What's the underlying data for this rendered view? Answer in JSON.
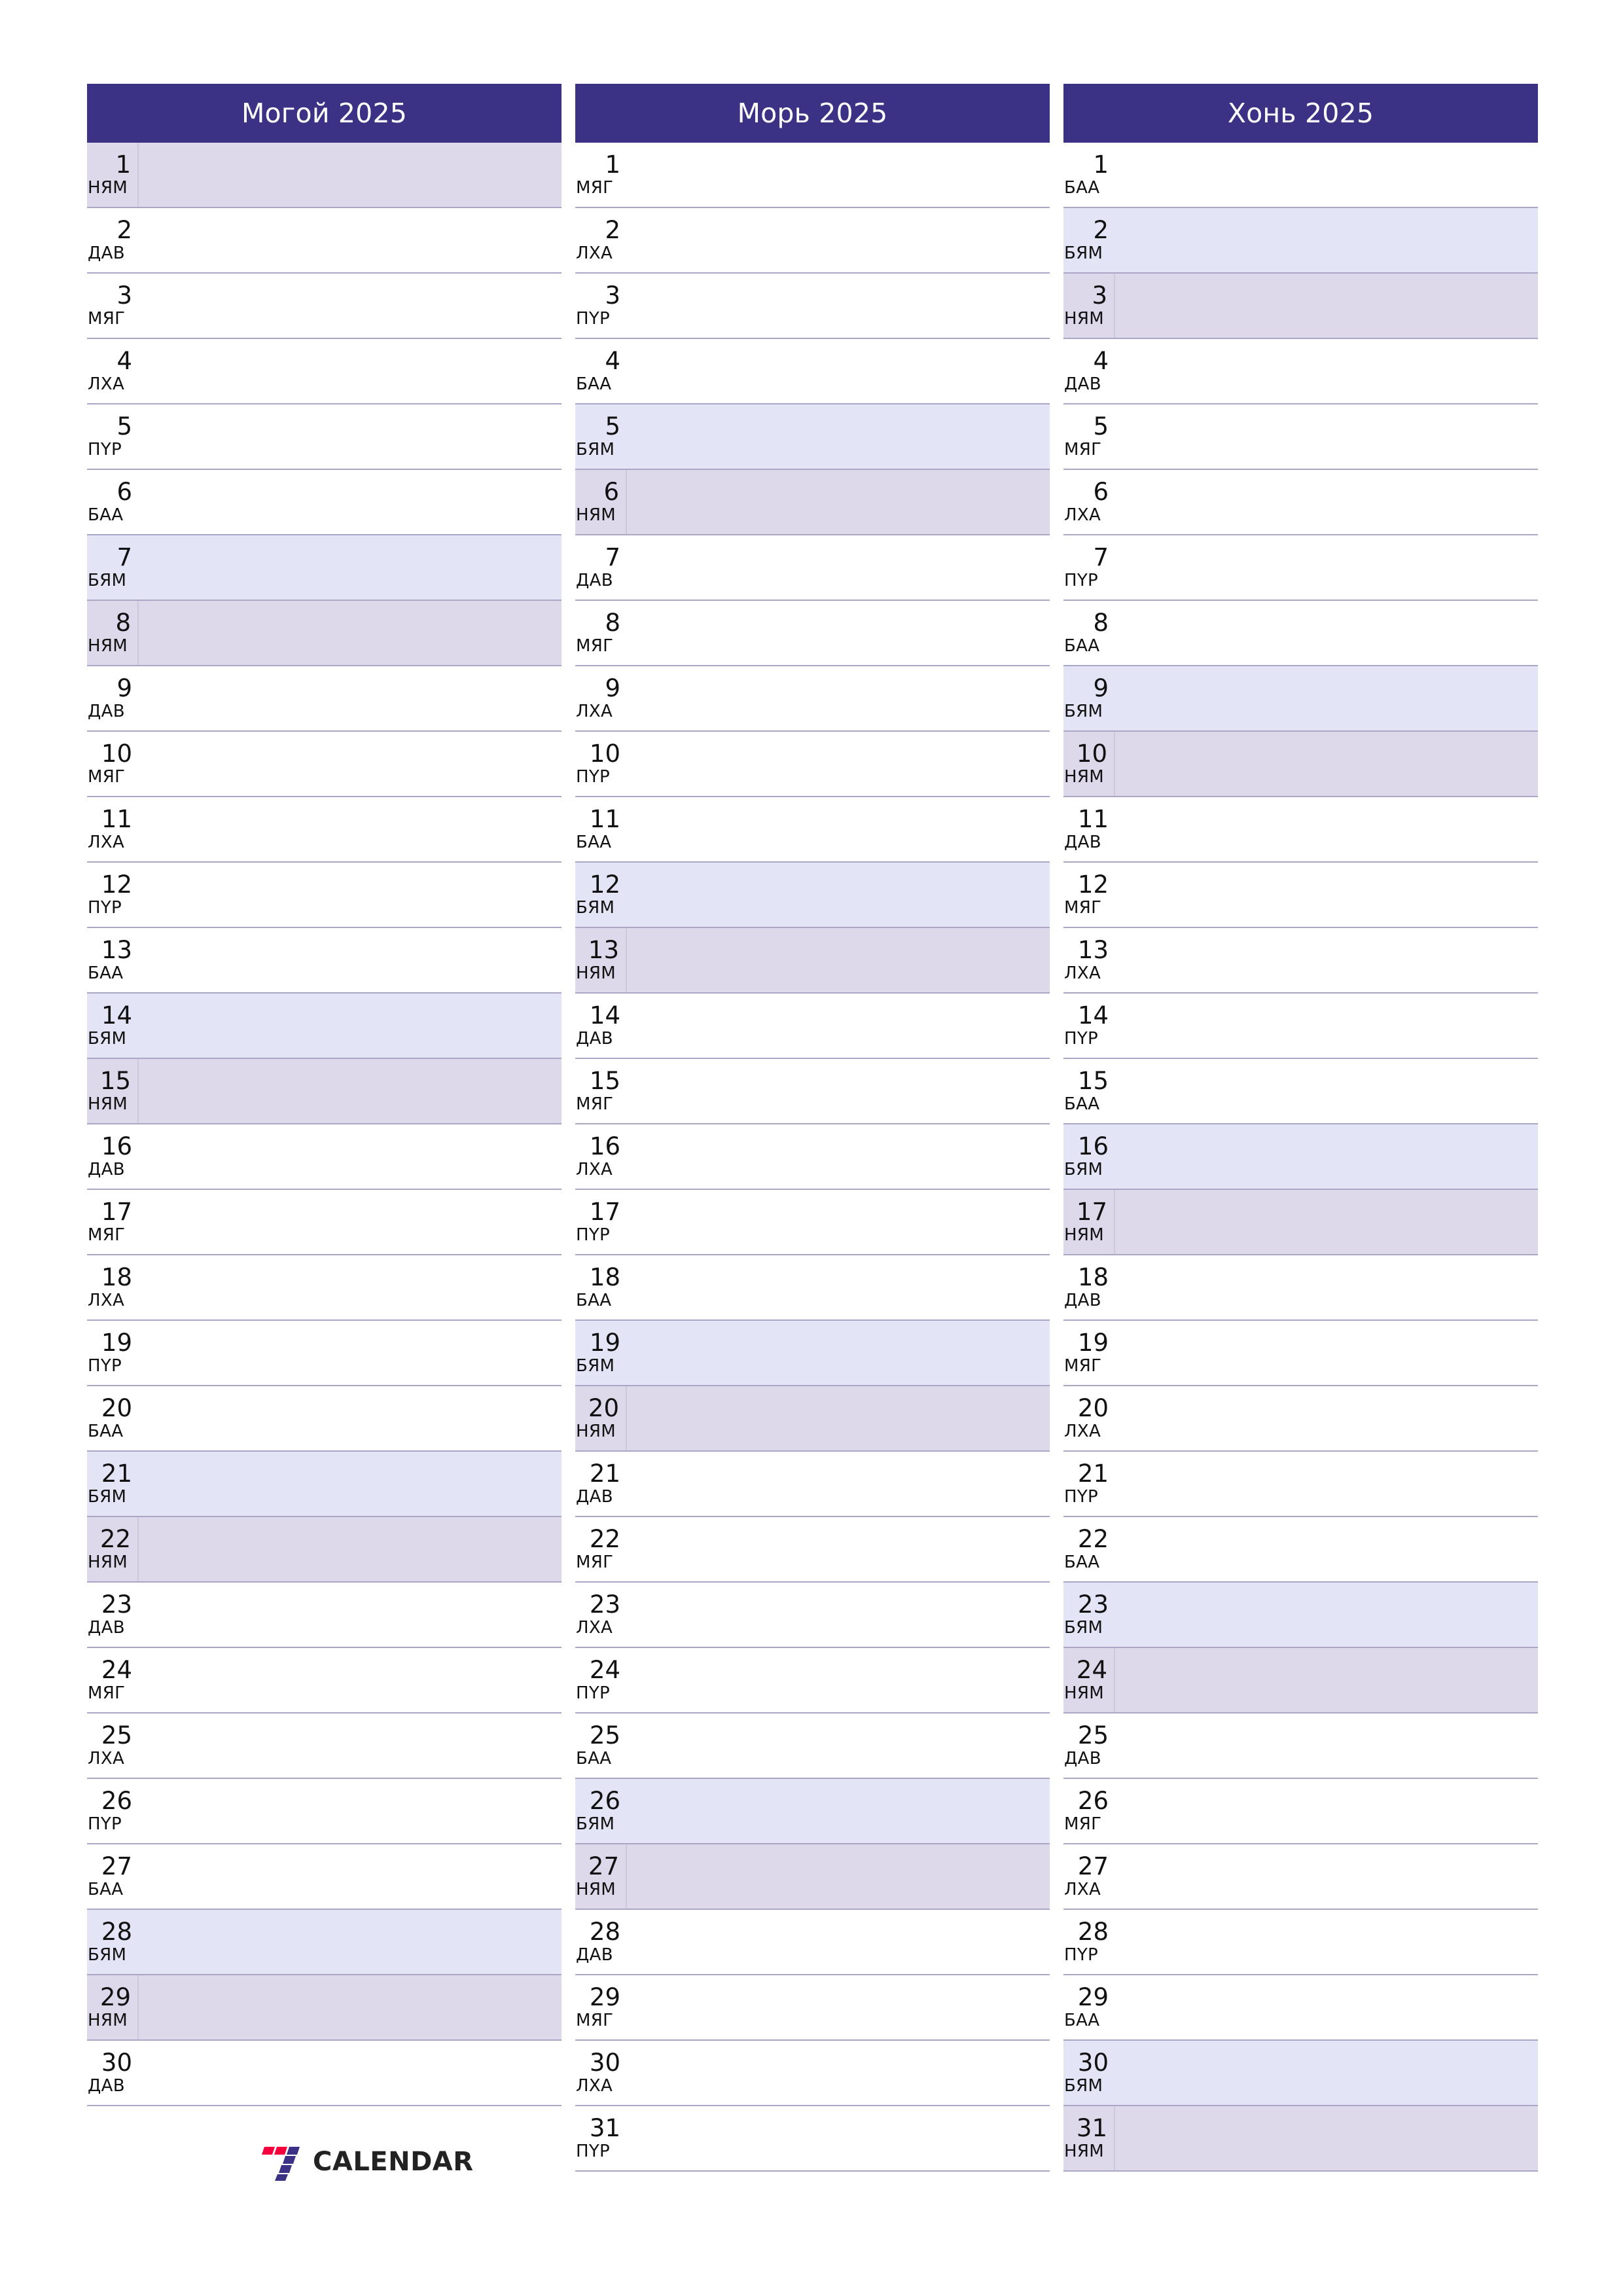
{
  "page": {
    "background_color": "#ffffff",
    "header_color": "#3b3185",
    "saturday_color": "#e3e4f5",
    "sunday_color": "#ddd9ea",
    "grid_line_color": "#a9a6c6"
  },
  "brand": {
    "name": "CALENDAR",
    "logo_icon": "seven-logo-icon",
    "logo_colors": {
      "red": "#f5003c",
      "blue": "#3b3185"
    }
  },
  "months": [
    {
      "title": "Могой 2025",
      "days": [
        {
          "n": "1",
          "wd": "НЯМ",
          "type": "sun"
        },
        {
          "n": "2",
          "wd": "ДАВ",
          "type": "weekday"
        },
        {
          "n": "3",
          "wd": "МЯГ",
          "type": "weekday"
        },
        {
          "n": "4",
          "wd": "ЛХА",
          "type": "weekday"
        },
        {
          "n": "5",
          "wd": "ПҮР",
          "type": "weekday"
        },
        {
          "n": "6",
          "wd": "БАА",
          "type": "weekday"
        },
        {
          "n": "7",
          "wd": "БЯМ",
          "type": "sat"
        },
        {
          "n": "8",
          "wd": "НЯМ",
          "type": "sun"
        },
        {
          "n": "9",
          "wd": "ДАВ",
          "type": "weekday"
        },
        {
          "n": "10",
          "wd": "МЯГ",
          "type": "weekday"
        },
        {
          "n": "11",
          "wd": "ЛХА",
          "type": "weekday"
        },
        {
          "n": "12",
          "wd": "ПҮР",
          "type": "weekday"
        },
        {
          "n": "13",
          "wd": "БАА",
          "type": "weekday"
        },
        {
          "n": "14",
          "wd": "БЯМ",
          "type": "sat"
        },
        {
          "n": "15",
          "wd": "НЯМ",
          "type": "sun"
        },
        {
          "n": "16",
          "wd": "ДАВ",
          "type": "weekday"
        },
        {
          "n": "17",
          "wd": "МЯГ",
          "type": "weekday"
        },
        {
          "n": "18",
          "wd": "ЛХА",
          "type": "weekday"
        },
        {
          "n": "19",
          "wd": "ПҮР",
          "type": "weekday"
        },
        {
          "n": "20",
          "wd": "БАА",
          "type": "weekday"
        },
        {
          "n": "21",
          "wd": "БЯМ",
          "type": "sat"
        },
        {
          "n": "22",
          "wd": "НЯМ",
          "type": "sun"
        },
        {
          "n": "23",
          "wd": "ДАВ",
          "type": "weekday"
        },
        {
          "n": "24",
          "wd": "МЯГ",
          "type": "weekday"
        },
        {
          "n": "25",
          "wd": "ЛХА",
          "type": "weekday"
        },
        {
          "n": "26",
          "wd": "ПҮР",
          "type": "weekday"
        },
        {
          "n": "27",
          "wd": "БАА",
          "type": "weekday"
        },
        {
          "n": "28",
          "wd": "БЯМ",
          "type": "sat"
        },
        {
          "n": "29",
          "wd": "НЯМ",
          "type": "sun"
        },
        {
          "n": "30",
          "wd": "ДАВ",
          "type": "weekday"
        }
      ]
    },
    {
      "title": "Морь 2025",
      "days": [
        {
          "n": "1",
          "wd": "МЯГ",
          "type": "weekday"
        },
        {
          "n": "2",
          "wd": "ЛХА",
          "type": "weekday"
        },
        {
          "n": "3",
          "wd": "ПҮР",
          "type": "weekday"
        },
        {
          "n": "4",
          "wd": "БАА",
          "type": "weekday"
        },
        {
          "n": "5",
          "wd": "БЯМ",
          "type": "sat"
        },
        {
          "n": "6",
          "wd": "НЯМ",
          "type": "sun"
        },
        {
          "n": "7",
          "wd": "ДАВ",
          "type": "weekday"
        },
        {
          "n": "8",
          "wd": "МЯГ",
          "type": "weekday"
        },
        {
          "n": "9",
          "wd": "ЛХА",
          "type": "weekday"
        },
        {
          "n": "10",
          "wd": "ПҮР",
          "type": "weekday"
        },
        {
          "n": "11",
          "wd": "БАА",
          "type": "weekday"
        },
        {
          "n": "12",
          "wd": "БЯМ",
          "type": "sat"
        },
        {
          "n": "13",
          "wd": "НЯМ",
          "type": "sun"
        },
        {
          "n": "14",
          "wd": "ДАВ",
          "type": "weekday"
        },
        {
          "n": "15",
          "wd": "МЯГ",
          "type": "weekday"
        },
        {
          "n": "16",
          "wd": "ЛХА",
          "type": "weekday"
        },
        {
          "n": "17",
          "wd": "ПҮР",
          "type": "weekday"
        },
        {
          "n": "18",
          "wd": "БАА",
          "type": "weekday"
        },
        {
          "n": "19",
          "wd": "БЯМ",
          "type": "sat"
        },
        {
          "n": "20",
          "wd": "НЯМ",
          "type": "sun"
        },
        {
          "n": "21",
          "wd": "ДАВ",
          "type": "weekday"
        },
        {
          "n": "22",
          "wd": "МЯГ",
          "type": "weekday"
        },
        {
          "n": "23",
          "wd": "ЛХА",
          "type": "weekday"
        },
        {
          "n": "24",
          "wd": "ПҮР",
          "type": "weekday"
        },
        {
          "n": "25",
          "wd": "БАА",
          "type": "weekday"
        },
        {
          "n": "26",
          "wd": "БЯМ",
          "type": "sat"
        },
        {
          "n": "27",
          "wd": "НЯМ",
          "type": "sun"
        },
        {
          "n": "28",
          "wd": "ДАВ",
          "type": "weekday"
        },
        {
          "n": "29",
          "wd": "МЯГ",
          "type": "weekday"
        },
        {
          "n": "30",
          "wd": "ЛХА",
          "type": "weekday"
        },
        {
          "n": "31",
          "wd": "ПҮР",
          "type": "weekday"
        }
      ]
    },
    {
      "title": "Хонь 2025",
      "days": [
        {
          "n": "1",
          "wd": "БАА",
          "type": "weekday"
        },
        {
          "n": "2",
          "wd": "БЯМ",
          "type": "sat"
        },
        {
          "n": "3",
          "wd": "НЯМ",
          "type": "sun"
        },
        {
          "n": "4",
          "wd": "ДАВ",
          "type": "weekday"
        },
        {
          "n": "5",
          "wd": "МЯГ",
          "type": "weekday"
        },
        {
          "n": "6",
          "wd": "ЛХА",
          "type": "weekday"
        },
        {
          "n": "7",
          "wd": "ПҮР",
          "type": "weekday"
        },
        {
          "n": "8",
          "wd": "БАА",
          "type": "weekday"
        },
        {
          "n": "9",
          "wd": "БЯМ",
          "type": "sat"
        },
        {
          "n": "10",
          "wd": "НЯМ",
          "type": "sun"
        },
        {
          "n": "11",
          "wd": "ДАВ",
          "type": "weekday"
        },
        {
          "n": "12",
          "wd": "МЯГ",
          "type": "weekday"
        },
        {
          "n": "13",
          "wd": "ЛХА",
          "type": "weekday"
        },
        {
          "n": "14",
          "wd": "ПҮР",
          "type": "weekday"
        },
        {
          "n": "15",
          "wd": "БАА",
          "type": "weekday"
        },
        {
          "n": "16",
          "wd": "БЯМ",
          "type": "sat"
        },
        {
          "n": "17",
          "wd": "НЯМ",
          "type": "sun"
        },
        {
          "n": "18",
          "wd": "ДАВ",
          "type": "weekday"
        },
        {
          "n": "19",
          "wd": "МЯГ",
          "type": "weekday"
        },
        {
          "n": "20",
          "wd": "ЛХА",
          "type": "weekday"
        },
        {
          "n": "21",
          "wd": "ПҮР",
          "type": "weekday"
        },
        {
          "n": "22",
          "wd": "БАА",
          "type": "weekday"
        },
        {
          "n": "23",
          "wd": "БЯМ",
          "type": "sat"
        },
        {
          "n": "24",
          "wd": "НЯМ",
          "type": "sun"
        },
        {
          "n": "25",
          "wd": "ДАВ",
          "type": "weekday"
        },
        {
          "n": "26",
          "wd": "МЯГ",
          "type": "weekday"
        },
        {
          "n": "27",
          "wd": "ЛХА",
          "type": "weekday"
        },
        {
          "n": "28",
          "wd": "ПҮР",
          "type": "weekday"
        },
        {
          "n": "29",
          "wd": "БАА",
          "type": "weekday"
        },
        {
          "n": "30",
          "wd": "БЯМ",
          "type": "sat"
        },
        {
          "n": "31",
          "wd": "НЯМ",
          "type": "sun"
        }
      ]
    }
  ]
}
